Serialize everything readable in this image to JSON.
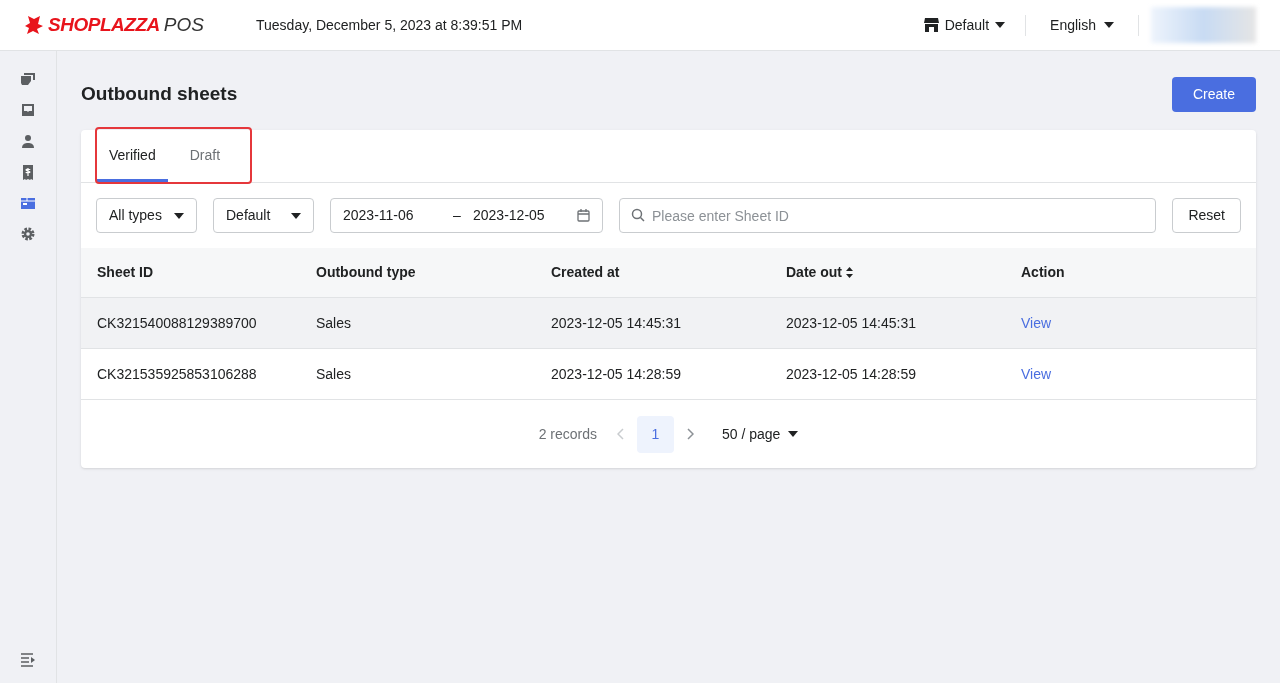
{
  "header": {
    "logo": {
      "brand": "SHOPLAZZA",
      "product": "POS"
    },
    "datetime": "Tuesday, December 5, 2023 at 8:39:51 PM",
    "store": "Default",
    "language": "English"
  },
  "sidebar": {
    "items": [
      {
        "kind": "cards",
        "selected": false
      },
      {
        "kind": "inbox",
        "selected": false
      },
      {
        "kind": "person",
        "selected": false
      },
      {
        "kind": "receipt",
        "selected": false
      },
      {
        "kind": "box",
        "selected": true
      },
      {
        "kind": "gear",
        "selected": false
      }
    ]
  },
  "page": {
    "title": "Outbound sheets",
    "create_button": "Create"
  },
  "tabs": {
    "highlighted": true,
    "items": [
      {
        "label": "Verified",
        "selected": true
      },
      {
        "label": "Draft",
        "selected": false
      }
    ]
  },
  "filters": {
    "type": "All types",
    "store": "Default",
    "date_from": "2023-11-06",
    "date_sep": "–",
    "date_to": "2023-12-05",
    "search": {
      "placeholder": "Please enter Sheet ID"
    },
    "reset": "Reset"
  },
  "table": {
    "columns": [
      {
        "label": "Sheet ID",
        "sortable": false
      },
      {
        "label": "Outbound type",
        "sortable": false
      },
      {
        "label": "Created at",
        "sortable": false
      },
      {
        "label": "Date out",
        "sortable": true
      },
      {
        "label": "Action",
        "sortable": false
      }
    ],
    "rows": [
      {
        "cells": [
          "CK321540088129389700",
          "Sales",
          "2023-12-05 14:45:31",
          "2023-12-05 14:45:31"
        ],
        "action": "View",
        "hovered": true
      },
      {
        "cells": [
          "CK321535925853106288",
          "Sales",
          "2023-12-05 14:28:59",
          "2023-12-05 14:28:59"
        ],
        "action": "View",
        "hovered": false
      }
    ]
  },
  "pagination": {
    "total": "2 records",
    "pages": [
      {
        "label": "1",
        "selected": true
      }
    ],
    "page_size": "50 / page"
  }
}
